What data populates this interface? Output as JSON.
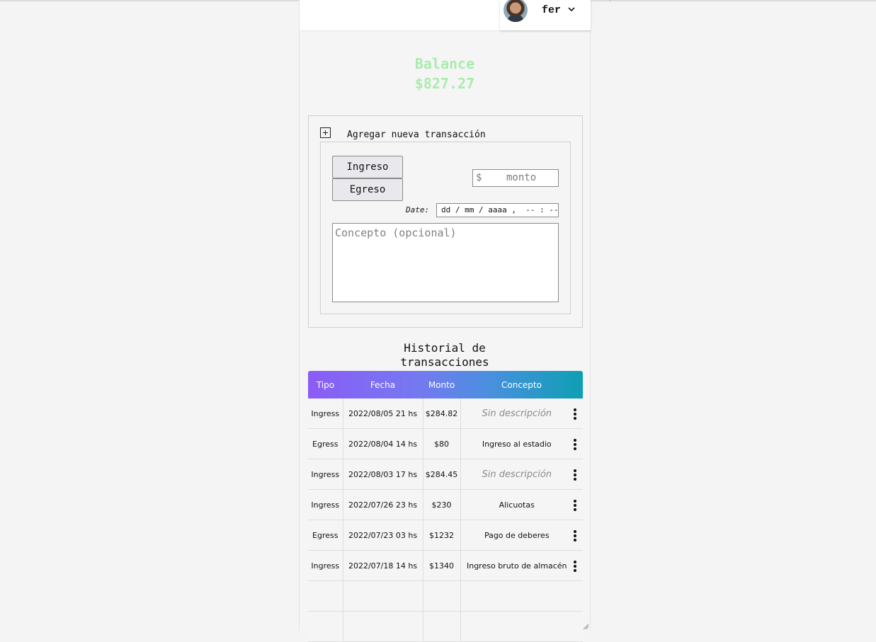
{
  "header": {
    "username": "fer"
  },
  "balance": {
    "label": "Balance",
    "amount": "$827.27",
    "color": "#a9ecad"
  },
  "add_transaction": {
    "title": "Agregar nueva transacción",
    "ingreso_label": "Ingreso",
    "egreso_label": "Egreso",
    "monto_prefix": "$",
    "monto_placeholder": "monto",
    "date_label": "Date:",
    "date_placeholder": "dd / mm / aaaa ,  -- : --",
    "concepto_placeholder": "Concepto (opcional)"
  },
  "history": {
    "title_line1": "Historial de",
    "title_line2": "transacciones",
    "columns": [
      "Tipo",
      "Fecha",
      "Monto",
      "Concepto"
    ],
    "header_gradient": [
      "#8b5cf6",
      "#0e9fb3"
    ],
    "rows": [
      {
        "tipo": "Ingress",
        "fecha": "2022/08/05 21 hs",
        "monto": "$284.82",
        "concepto": "Sin descripción",
        "muted": true
      },
      {
        "tipo": "Egress",
        "fecha": "2022/08/04 14 hs",
        "monto": "$80",
        "concepto": "Ingreso al estadio",
        "muted": false
      },
      {
        "tipo": "Ingress",
        "fecha": "2022/08/03 17 hs",
        "monto": "$284.45",
        "concepto": "Sin descripción",
        "muted": true
      },
      {
        "tipo": "Ingress",
        "fecha": "2022/07/26 23 hs",
        "monto": "$230",
        "concepto": "Alicuotas",
        "muted": false
      },
      {
        "tipo": "Egress",
        "fecha": "2022/07/23 03 hs",
        "monto": "$1232",
        "concepto": "Pago de deberes",
        "muted": false
      },
      {
        "tipo": "Ingress",
        "fecha": "2022/07/18 14 hs",
        "monto": "$1340",
        "concepto": "Ingreso bruto de almacén",
        "muted": false
      }
    ],
    "empty_rows": 2
  }
}
